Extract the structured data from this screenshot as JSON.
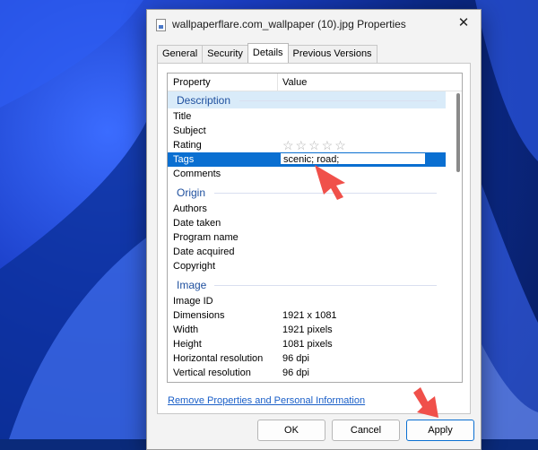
{
  "window": {
    "title": "wallpaperflare.com_wallpaper (10).jpg Properties",
    "close_icon": "✕"
  },
  "tabs": [
    {
      "label": "General"
    },
    {
      "label": "Security"
    },
    {
      "label": "Details"
    },
    {
      "label": "Previous Versions"
    }
  ],
  "columns": {
    "property": "Property",
    "value": "Value"
  },
  "groups": {
    "description": "Description",
    "origin": "Origin",
    "image": "Image"
  },
  "rows": {
    "title": {
      "k": "Title",
      "v": ""
    },
    "subject": {
      "k": "Subject",
      "v": ""
    },
    "rating": {
      "k": "Rating",
      "v": "☆☆☆☆☆"
    },
    "tags": {
      "k": "Tags",
      "v": "scenic; road;"
    },
    "comments": {
      "k": "Comments",
      "v": ""
    },
    "authors": {
      "k": "Authors",
      "v": ""
    },
    "date_taken": {
      "k": "Date taken",
      "v": ""
    },
    "program_name": {
      "k": "Program name",
      "v": ""
    },
    "date_acquired": {
      "k": "Date acquired",
      "v": ""
    },
    "copyright": {
      "k": "Copyright",
      "v": ""
    },
    "image_id": {
      "k": "Image ID",
      "v": ""
    },
    "dimensions": {
      "k": "Dimensions",
      "v": "1921 x 1081"
    },
    "width": {
      "k": "Width",
      "v": "1921 pixels"
    },
    "height": {
      "k": "Height",
      "v": "1081 pixels"
    },
    "h_res": {
      "k": "Horizontal resolution",
      "v": "96 dpi"
    },
    "v_res": {
      "k": "Vertical resolution",
      "v": "96 dpi"
    }
  },
  "link": {
    "remove": "Remove Properties and Personal Information"
  },
  "buttons": {
    "ok": "OK",
    "cancel": "Cancel",
    "apply": "Apply"
  },
  "colors": {
    "selection": "#0a6fd1",
    "group_text": "#1e4f9e",
    "arrow": "#f0504a"
  }
}
